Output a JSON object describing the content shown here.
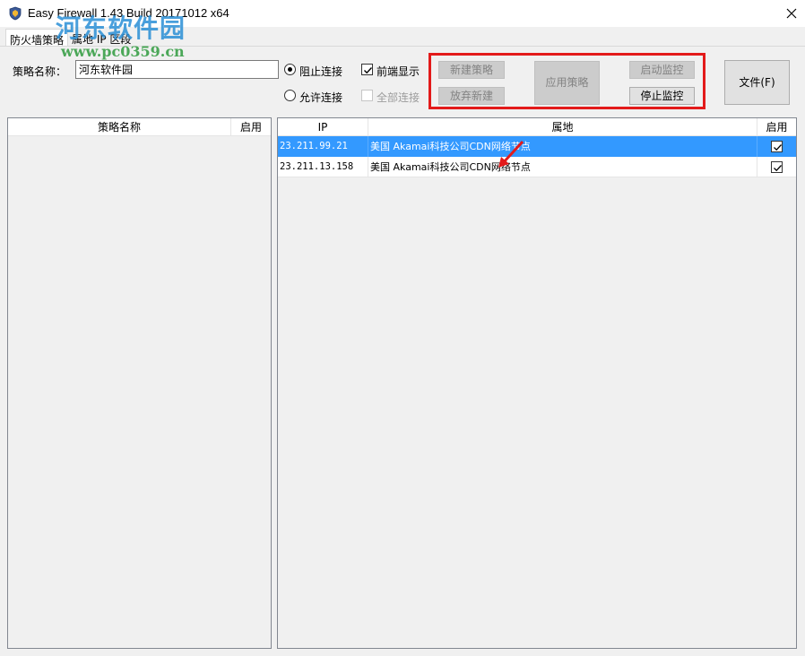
{
  "window": {
    "title": "Easy Firewall 1.43 Build 20171012 x64"
  },
  "watermark": {
    "logo_text": "河东软件园",
    "url": "www.pc0359.cn"
  },
  "tabs": [
    {
      "label": "防火墙策略",
      "active": true
    },
    {
      "label": "属地 IP 区段",
      "active": false
    }
  ],
  "form": {
    "policy_name_label": "策略名称：",
    "policy_name_value": "河东软件园",
    "radio_block_label": "阻止连接",
    "radio_allow_label": "允许连接",
    "radio_selected": "block",
    "check_foreground_label": "前端显示",
    "check_foreground_checked": true,
    "check_all_label": "全部连接",
    "check_all_checked": false
  },
  "buttons": {
    "new_policy": "新建策略",
    "discard_new": "放弃新建",
    "apply_policy": "应用策略",
    "start_monitor": "启动监控",
    "stop_monitor": "停止监控",
    "file": "文件(F)"
  },
  "policy_list": {
    "columns": [
      "策略名称",
      "启用"
    ],
    "rows": []
  },
  "ip_list": {
    "columns": [
      "IP",
      "属地",
      "启用"
    ],
    "rows": [
      {
        "ip": "23.211.99.21",
        "location": "美国 Akamai科技公司CDN网络节点",
        "enabled": true,
        "selected": true
      },
      {
        "ip": "23.211.13.158",
        "location": "美国 Akamai科技公司CDN网络节点",
        "enabled": true,
        "selected": false
      }
    ]
  },
  "colors": {
    "highlight_box": "#e31a1a",
    "selection": "#3399ff",
    "watermark_logo": "#2a8fd6",
    "watermark_url": "#3aa048"
  }
}
